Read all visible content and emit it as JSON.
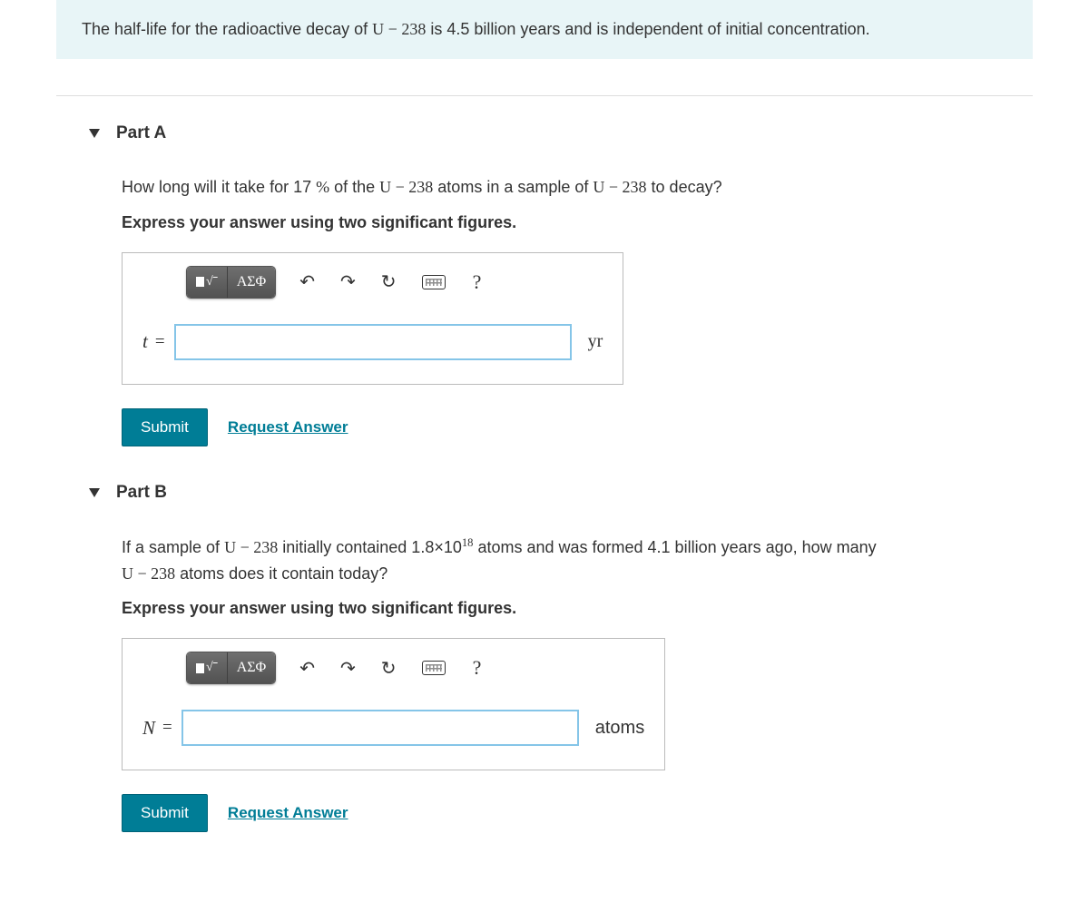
{
  "intro": {
    "prefix": "The half-life for the radioactive decay of ",
    "nuclide_sym": "U",
    "nuclide_dash": " − ",
    "nuclide_mass": "238",
    "suffix": " is 4.5 billion years and is independent of initial concentration."
  },
  "toolbar": {
    "greek_label": "ΑΣΦ",
    "help_label": "?"
  },
  "actions": {
    "submit": "Submit",
    "request": "Request Answer"
  },
  "partA": {
    "title": "Part A",
    "q_prefix": "How long will it take for 17 ",
    "q_percent": "%",
    "q_mid1": " of the ",
    "q_u1_sym": "U",
    "q_u1_dash": " − ",
    "q_u1_mass": "238",
    "q_mid2": " atoms in a sample of ",
    "q_u2_sym": "U",
    "q_u2_dash": " − ",
    "q_u2_mass": "238",
    "q_suffix": " to decay?",
    "instruction": "Express your answer using two significant figures.",
    "var": "t",
    "eq": "=",
    "unit": "yr",
    "value": ""
  },
  "partB": {
    "title": "Part B",
    "q_prefix": "If a sample of ",
    "q_u1_sym": "U",
    "q_u1_dash": " − ",
    "q_u1_mass": "238",
    "q_mid1": " initially contained 1.8×10",
    "q_exp": "18",
    "q_mid2": " atoms and was formed 4.1 billion years ago, how many ",
    "q_u2_sym": "U",
    "q_u2_dash": " − ",
    "q_u2_mass": "238",
    "q_suffix": " atoms does it contain today?",
    "instruction": "Express your answer using two significant figures.",
    "var": "N",
    "eq": "=",
    "unit": "atoms",
    "value": ""
  }
}
